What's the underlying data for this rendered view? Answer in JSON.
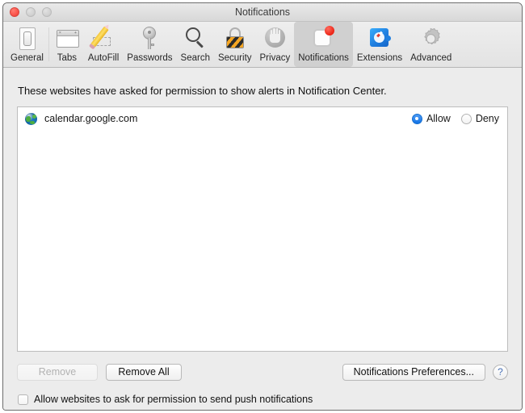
{
  "window": {
    "title": "Notifications",
    "traffic_lights": [
      {
        "name": "close",
        "state": "active"
      },
      {
        "name": "minimize",
        "state": "disabled"
      },
      {
        "name": "zoom",
        "state": "disabled"
      }
    ]
  },
  "toolbar": {
    "items": [
      {
        "label": "General",
        "icon": "general-switch-icon",
        "selected": false
      },
      {
        "label": "Tabs",
        "icon": "tabs-window-icon",
        "selected": false
      },
      {
        "label": "AutoFill",
        "icon": "autofill-pencil-icon",
        "selected": false
      },
      {
        "label": "Passwords",
        "icon": "key-icon",
        "selected": false
      },
      {
        "label": "Search",
        "icon": "search-magnifier-icon",
        "selected": false
      },
      {
        "label": "Security",
        "icon": "security-padlock-icon",
        "selected": false
      },
      {
        "label": "Privacy",
        "icon": "privacy-hand-icon",
        "selected": false
      },
      {
        "label": "Notifications",
        "icon": "notifications-badge-icon",
        "selected": true
      },
      {
        "label": "Extensions",
        "icon": "extensions-puzzle-icon",
        "selected": false
      },
      {
        "label": "Advanced",
        "icon": "advanced-gear-icon",
        "selected": false
      }
    ]
  },
  "main": {
    "description": "These websites have asked for permission to show alerts in Notification Center.",
    "radio_options": {
      "allow": "Allow",
      "deny": "Deny"
    },
    "sites": [
      {
        "name": "calendar.google.com",
        "icon": "globe-icon",
        "permission": "Allow"
      }
    ]
  },
  "footer": {
    "remove_label": "Remove",
    "remove_enabled": false,
    "remove_all_label": "Remove All",
    "notifications_preferences_label": "Notifications Preferences...",
    "help_label": "?",
    "push_checkbox_label": "Allow websites to ask for permission to send push notifications",
    "push_checkbox_checked": false
  },
  "colors": {
    "accent_blue": "#1273e6",
    "badge_red": "#ea1f10",
    "window_bg": "#ececec",
    "list_bg": "#ffffff",
    "help_glyph": "#4a72b8"
  }
}
